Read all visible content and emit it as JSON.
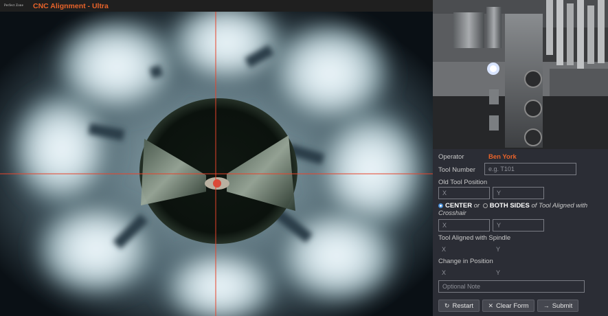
{
  "titlebar": {
    "logo_text": "Perfect Zone",
    "title": "CNC Alignment - Ultra"
  },
  "form": {
    "operator_label": "Operator",
    "operator_name": "Ben York",
    "tool_number_label": "Tool Number",
    "tool_number_placeholder": "e.g. T101",
    "old_position_label": "Old Tool Position",
    "x_placeholder": "X",
    "y_placeholder": "Y",
    "alignment_option_center": "CENTER",
    "alignment_or": "or",
    "alignment_option_both": "BOTH SIDES",
    "alignment_suffix": "of Tool Aligned with",
    "alignment_suffix2": "Crosshair",
    "alignment_selected": "CENTER",
    "spindle_label": "Tool Aligned with Spindle",
    "spindle_x": "X",
    "spindle_y": "Y",
    "change_label": "Change in Position",
    "change_x": "X",
    "change_y": "Y",
    "note_placeholder": "Optional Note"
  },
  "buttons": {
    "restart": "Restart",
    "clear": "Clear Form",
    "submit": "Submit"
  },
  "icons": {
    "restart": "restart-icon",
    "clear": "close-icon",
    "submit": "arrow-right-icon"
  },
  "colors": {
    "accent": "#e8632a",
    "panel_bg": "#2b2d35",
    "crosshair": "#e8432a"
  }
}
